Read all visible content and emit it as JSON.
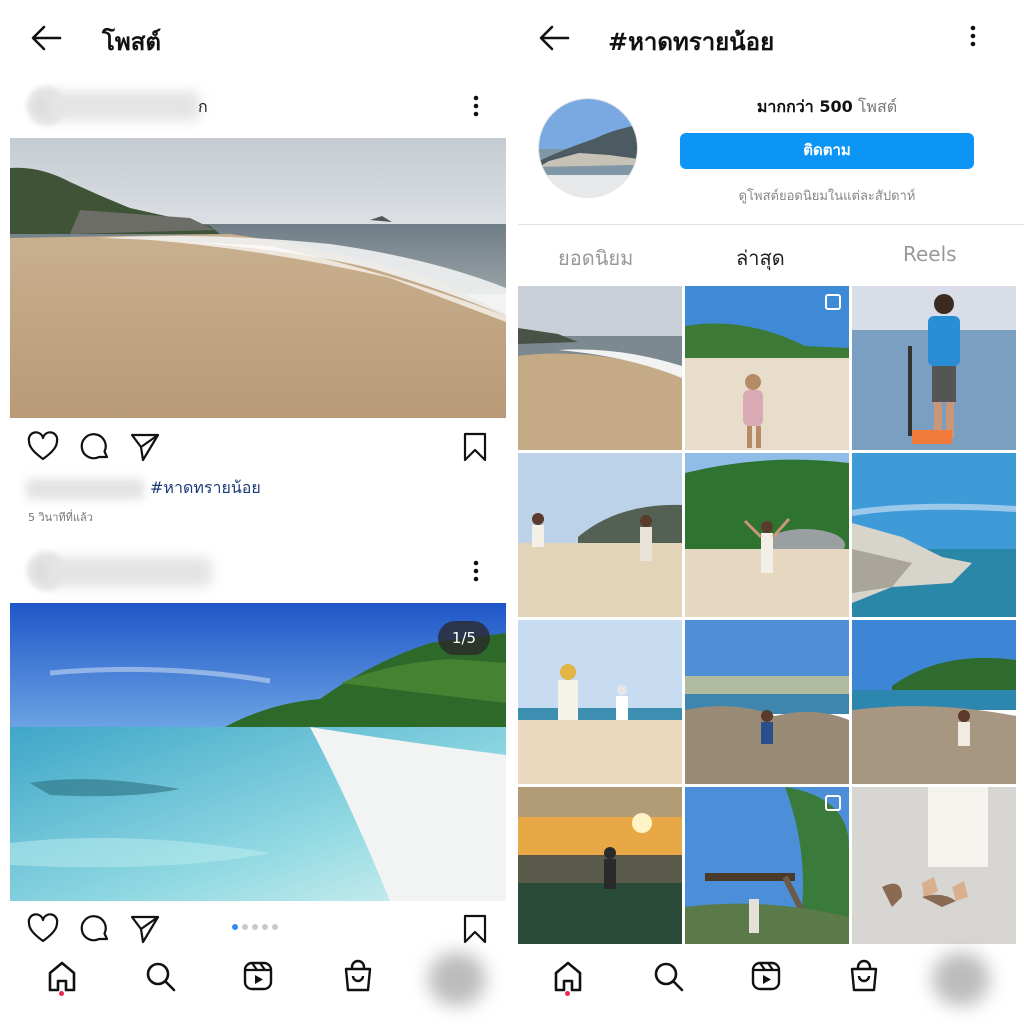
{
  "left": {
    "title": "โพสต์",
    "post1": {
      "name_tail": "ก",
      "caption_hashtag": "#หาดทรายน้อย",
      "time_ago": "5 วินาทีที่แล้ว"
    },
    "post2": {
      "counter": "1/5",
      "carousel": {
        "total": 5,
        "active": 1
      }
    }
  },
  "right": {
    "title": "#หาดทรายน้อย",
    "post_count_value": "มากกว่า 500",
    "post_count_unit": "โพสต์",
    "follow_label": "ติดตาม",
    "follow_note": "ดูโพสต์ยอดนิยมในแต่ละสัปดาห์",
    "tabs": [
      {
        "label": "ยอดนิยม",
        "active": false
      },
      {
        "label": "ล่าสุด",
        "active": true
      },
      {
        "label": "Reels",
        "active": false
      }
    ]
  },
  "nav_icons": [
    "home-icon",
    "search-icon",
    "reels-icon",
    "shop-icon",
    "profile-avatar"
  ],
  "colors": {
    "accent": "#0d95f6",
    "hashtag": "#1d3a78",
    "nav_dot": "#ed2556"
  }
}
